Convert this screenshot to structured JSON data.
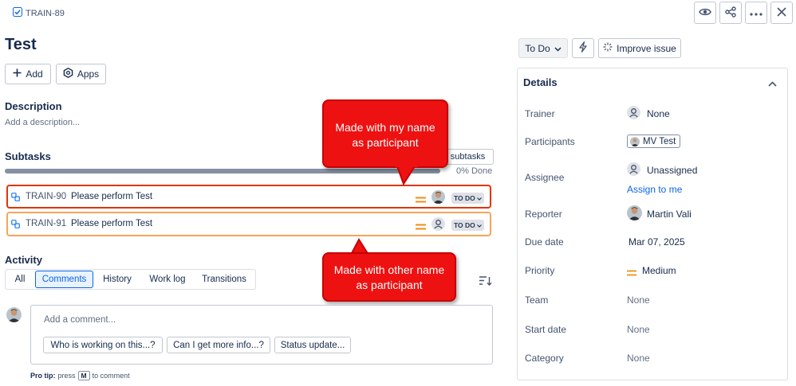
{
  "header": {
    "issue_key": "TRAIN-89",
    "title": "Test",
    "add_label": "Add",
    "apps_label": "Apps"
  },
  "description": {
    "heading": "Description",
    "placeholder": "Add a description..."
  },
  "subtasks": {
    "heading": "Subtasks",
    "button_label": "subtasks",
    "progress_text": "0% Done",
    "progress_fraction": 0,
    "items": [
      {
        "key": "TRAIN-90",
        "summary": "Please perform Test",
        "status": "TO DO"
      },
      {
        "key": "TRAIN-91",
        "summary": "Please perform Test",
        "status": "TO DO"
      }
    ]
  },
  "callouts": {
    "top": "Made with my name as participant",
    "bottom": "Made with other name as participant"
  },
  "activity": {
    "heading": "Activity",
    "tabs": [
      "All",
      "Comments",
      "History",
      "Work log",
      "Transitions"
    ],
    "active_tab": "Comments",
    "comment_placeholder": "Add a comment...",
    "quick_replies": [
      "Who is working on this...?",
      "Can I get more info...?",
      "Status update..."
    ],
    "pro_tip_prefix": "Pro tip:",
    "pro_tip_press": "press",
    "pro_tip_key": "M",
    "pro_tip_suffix": "to comment"
  },
  "toolbar": {
    "status_label": "To Do",
    "improve_label": "Improve issue"
  },
  "details": {
    "heading": "Details",
    "fields": {
      "trainer_label": "Trainer",
      "trainer_value": "None",
      "participants_label": "Participants",
      "participants_value": "MV Test",
      "assignee_label": "Assignee",
      "assignee_value": "Unassigned",
      "assign_to_me": "Assign to me",
      "reporter_label": "Reporter",
      "reporter_value": "Martin Vali",
      "due_label": "Due date",
      "due_value": "Mar 07, 2025",
      "priority_label": "Priority",
      "priority_value": "Medium",
      "team_label": "Team",
      "team_value": "None",
      "start_label": "Start date",
      "start_value": "None",
      "category_label": "Category",
      "category_value": "None"
    }
  },
  "colors": {
    "accent_blue": "#0c66e4",
    "priority_orange": "#f18d13",
    "callout_red": "#ee1111",
    "row_highlight_red": "#de350b",
    "row_highlight_orange": "#f5a55a"
  }
}
